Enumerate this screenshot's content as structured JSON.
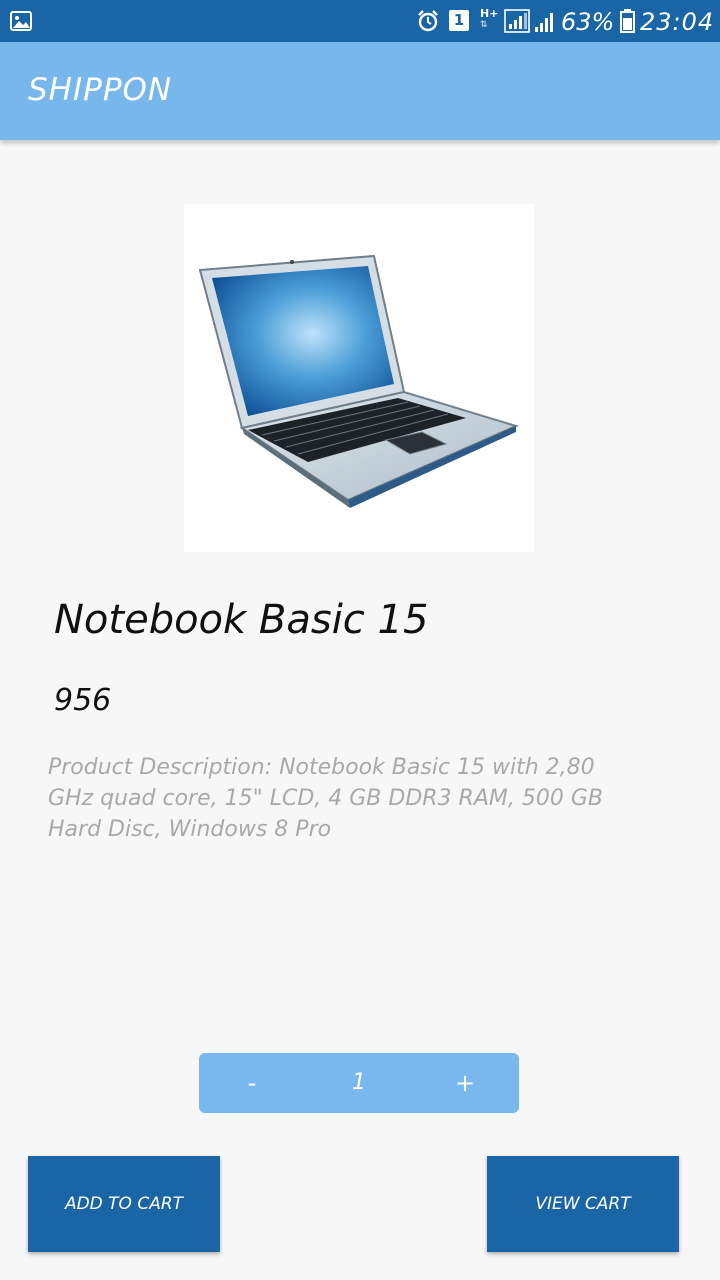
{
  "status_bar": {
    "notification_count": "1",
    "network_type": "H+",
    "battery_percent": "63%",
    "time": "23:04"
  },
  "app_bar": {
    "title": "SHIPPON"
  },
  "product": {
    "title": "Notebook Basic 15",
    "price": "956",
    "description": "Product Description: Notebook Basic 15 with 2,80 GHz quad core, 15\" LCD, 4 GB DDR3 RAM, 500 GB Hard Disc, Windows 8 Pro",
    "image_icon": "laptop-illustration"
  },
  "quantity": {
    "minus_label": "-",
    "value": "1",
    "plus_label": "+"
  },
  "actions": {
    "add_to_cart_label": "ADD TO CART",
    "view_cart_label": "VIEW CART"
  },
  "colors": {
    "status_bar": "#1a65a6",
    "app_bar": "#77b7ec",
    "stepper": "#79b8ee",
    "button": "#1a65a6",
    "background": "#f7f7f7"
  }
}
